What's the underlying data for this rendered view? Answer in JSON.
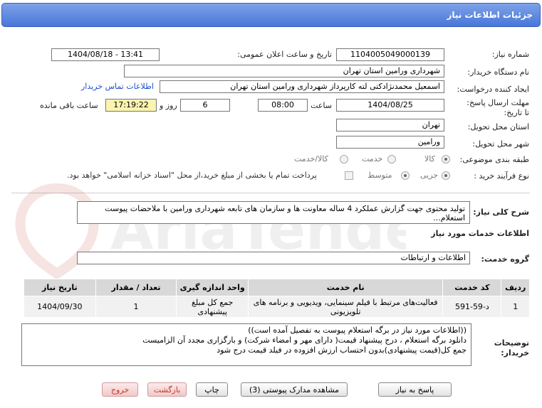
{
  "header": {
    "title": "جزئیات اطلاعات نیاز"
  },
  "fields": {
    "need_number_label": "شماره نیاز:",
    "need_number": "1104005049000139",
    "announce_label": "تاریخ و ساعت اعلان عمومی:",
    "announce_value": "1404/08/18 - 13:41",
    "buyer_org_label": "نام دستگاه خریدار:",
    "buyer_org": "شهرداری ورامین استان تهران",
    "creator_label": "ایجاد کننده درخواست:",
    "creator": "اسمعیل محمدنژادکتی لته کارپرداز شهرداری ورامین استان تهران",
    "contact_link": "اطلاعات تماس خریدار",
    "deadline_label": "مهلت ارسال پاسخ: تا تاریخ:",
    "deadline_date": "1404/08/25",
    "time_label": "ساعت",
    "deadline_time": "08:00",
    "days_value": "6",
    "days_label": "روز و",
    "remaining_time": "17:19:22",
    "remaining_label": "ساعت باقی مانده",
    "province_label": "استان محل تحویل:",
    "province": "تهران",
    "city_label": "شهر محل تحویل:",
    "city": "ورامین",
    "category_label": "طبقه بندی موضوعی:",
    "category_options": [
      "کالا",
      "خدمت",
      "کالا/خدمت"
    ],
    "process_label": "نوع فرآیند خرید :",
    "process_options": [
      "جزیی",
      "متوسط"
    ],
    "payment_note": "پرداخت تمام یا بخشی از مبلغ خرید،از محل \"اسناد خزانه اسلامی\" خواهد بود."
  },
  "description": {
    "label": "شرح کلی نیاز:",
    "text": "تولید محتوی جهت گزارش عملکرد 4 ساله معاونت ها و سازمان های تابعه شهرداری ورامین با ملاحضات پیوست استعلام..."
  },
  "services": {
    "section_title": "اطلاعات خدمات مورد نیاز",
    "group_label": "گروه خدمت:",
    "group_value": "اطلاعات و ارتباطات",
    "columns": [
      "ردیف",
      "کد خدمت",
      "نام خدمت",
      "واحد اندازه گیری",
      "تعداد / مقدار",
      "تاریخ نیاز"
    ],
    "rows": [
      {
        "row": "1",
        "code": "د-59-591",
        "name": "فعالیت‌های مرتبط با فیلم سینمایی، ویدیویی و برنامه های تلویزیونی",
        "unit": "جمع کل مبلغ پیشنهادی",
        "qty": "1",
        "date": "1404/09/30"
      }
    ]
  },
  "buyer_notes": {
    "label": "توضیحات خریدار:",
    "line1": "((اطلاعات مورد نیاز در برگه استعلام پیوست به تفصیل آمده است))",
    "line2": "دانلود برگه استعلام ، درج پیشنهاد قیمت( دارای مهر و امضاء شرکت) و بارگزاری مجدد آن الزامیست",
    "line3": "جمع کل(قیمت پیشنهادی)بدون احتساب ارزش افزوده در فیلد قیمت درج شود"
  },
  "buttons": {
    "reply": "پاسخ به نیاز",
    "attachments": "مشاهده مدارک پیوستی (3)",
    "print": "چاپ",
    "back": "بازگشت",
    "exit": "خروج"
  },
  "watermark": {
    "text": "AriaTender.net"
  },
  "colors": {
    "title_bar": "#4877d9",
    "link": "#1d4fd0",
    "highlight": "#fbf4b0"
  }
}
